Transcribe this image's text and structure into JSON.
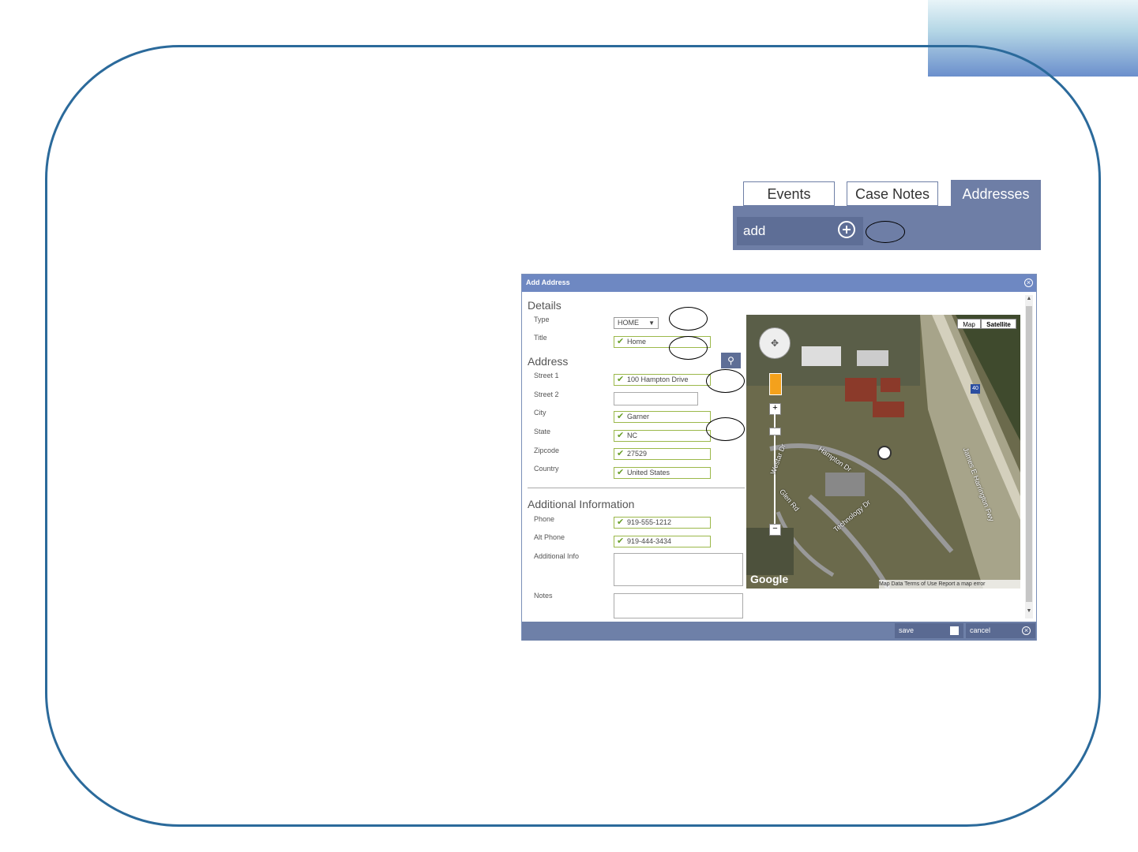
{
  "tabs": [
    {
      "label": "Events",
      "active": false
    },
    {
      "label": "Case Notes",
      "active": false
    },
    {
      "label": "Addresses",
      "active": true
    }
  ],
  "add_bar": {
    "label": "add",
    "icon": "plus-circle-icon"
  },
  "dialog": {
    "title": "Add Address",
    "details": {
      "section": "Details",
      "type_label": "Type",
      "type_value": "HOME",
      "title_label": "Title",
      "title_value": "Home"
    },
    "address": {
      "section": "Address",
      "street1_label": "Street 1",
      "street1_value": "100 Hampton Drive",
      "street2_label": "Street 2",
      "street2_value": "",
      "city_label": "City",
      "city_value": "Garner",
      "state_label": "State",
      "state_value": "NC",
      "zip_label": "Zipcode",
      "zip_value": "27529",
      "country_label": "Country",
      "country_value": "United States"
    },
    "additional": {
      "section": "Additional Information",
      "phone_label": "Phone",
      "phone_value": "919-555-1212",
      "alt_phone_label": "Alt Phone",
      "alt_phone_value": "919-444-3434",
      "info_label": "Additional Info",
      "notes_label": "Notes"
    },
    "footer": {
      "save": "save",
      "cancel": "cancel"
    }
  },
  "map": {
    "map_btn": "Map",
    "satellite_btn": "Satellite",
    "footer": "Map Data  Terms of Use  Report a map error",
    "logo": "Google",
    "roads": [
      "Hampton Dr",
      "Technology Dr",
      "James E Harrington Fwy",
      "Glen Rd",
      "Westar Dr"
    ],
    "shield": "40"
  },
  "colors": {
    "accent": "#6e7ea6",
    "frame": "#2b6a9b",
    "field_border": "#9bb84a"
  }
}
